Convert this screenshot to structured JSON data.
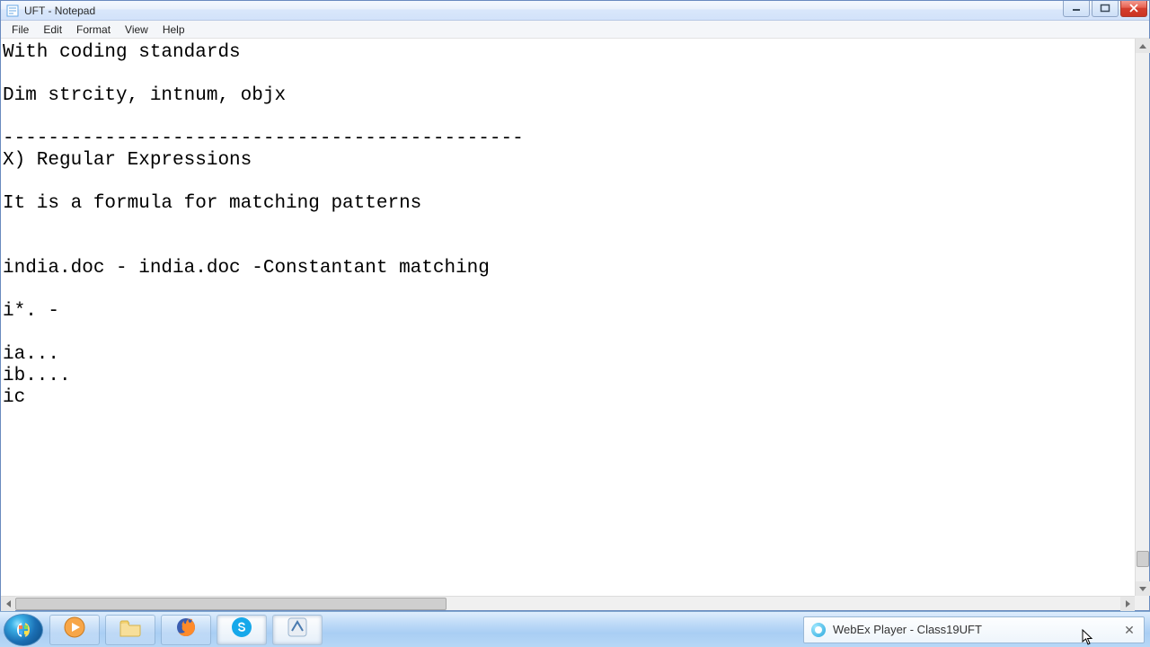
{
  "window": {
    "title": "UFT - Notepad"
  },
  "menubar": {
    "items": [
      "File",
      "Edit",
      "Format",
      "View",
      "Help"
    ]
  },
  "editor": {
    "content": "With coding standards\n\nDim strcity, intnum, objx\n\n----------------------------------------------\nX) Regular Expressions\n\nIt is a formula for matching patterns\n\n\nindia.doc - india.doc -Constantant matching\n\ni*. -\n\nia...\nib....\nic"
  },
  "notification": {
    "text": "WebEx Player - Class19UFT"
  },
  "icons": {
    "wmp": "media-player-icon",
    "explorer": "folder-icon",
    "firefox": "firefox-icon",
    "skype": "skype-icon",
    "uft": "uft-icon"
  }
}
